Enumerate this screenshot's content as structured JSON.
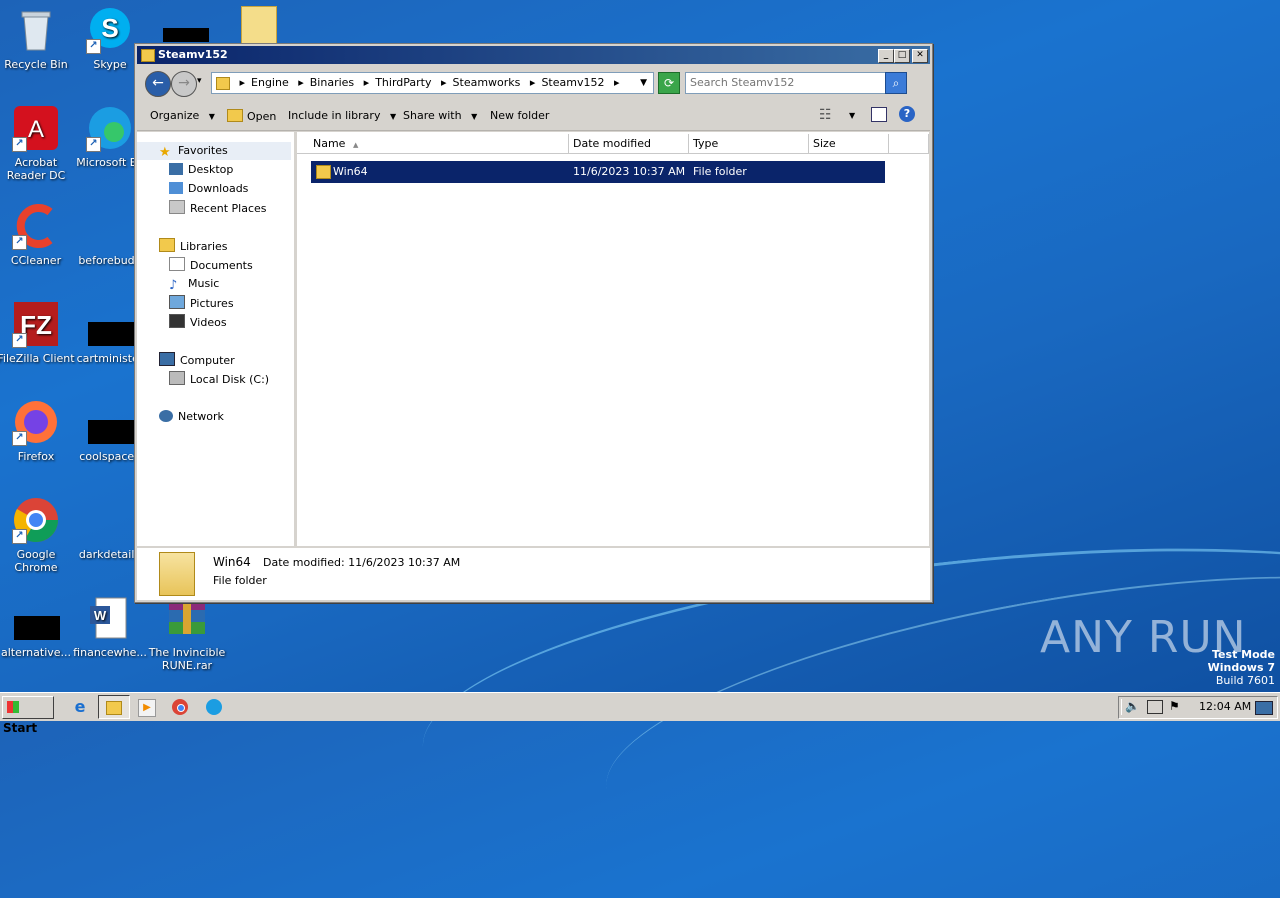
{
  "desktop": {
    "icons": [
      {
        "label": "Recycle Bin"
      },
      {
        "label": "Skype"
      },
      {
        "label": "Acrobat Reader DC"
      },
      {
        "label": "Microsoft Ed"
      },
      {
        "label": "CCleaner"
      },
      {
        "label": "beforebudg"
      },
      {
        "label": "FileZilla Client"
      },
      {
        "label": "cartminister"
      },
      {
        "label": "Firefox"
      },
      {
        "label": "coolspace.j"
      },
      {
        "label": "Google Chrome"
      },
      {
        "label": "darkdetaile"
      },
      {
        "label": "alternative..."
      },
      {
        "label": "financewhe..."
      },
      {
        "label": "The Invincible RUNE.rar"
      }
    ]
  },
  "window": {
    "title": "Steamv152",
    "breadcrumbs": [
      "Engine",
      "Binaries",
      "ThirdParty",
      "Steamworks",
      "Steamv152"
    ],
    "search_placeholder": "Search Steamv152",
    "toolbar": {
      "organize": "Organize",
      "open": "Open",
      "include_in_library": "Include in library",
      "share_with": "Share with",
      "new_folder": "New folder"
    },
    "nav": {
      "favorites": "Favorites",
      "desktop": "Desktop",
      "downloads": "Downloads",
      "recent_places": "Recent Places",
      "libraries": "Libraries",
      "documents": "Documents",
      "music": "Music",
      "pictures": "Pictures",
      "videos": "Videos",
      "computer": "Computer",
      "local_disk": "Local Disk (C:)",
      "network": "Network"
    },
    "columns": {
      "name": "Name",
      "date_modified": "Date modified",
      "type": "Type",
      "size": "Size"
    },
    "rows": [
      {
        "name": "Win64",
        "date_modified": "11/6/2023 10:37 AM",
        "type": "File folder",
        "size": ""
      }
    ],
    "details": {
      "name": "Win64",
      "date_label": "Date modified: 11/6/2023 10:37 AM",
      "type": "File folder"
    }
  },
  "taskbar": {
    "start": "Start",
    "clock": "12:04 AM"
  },
  "watermark": {
    "brand": "ANY RUN",
    "line1": "Test Mode",
    "line2": "Windows 7",
    "line3": "Build 7601"
  }
}
